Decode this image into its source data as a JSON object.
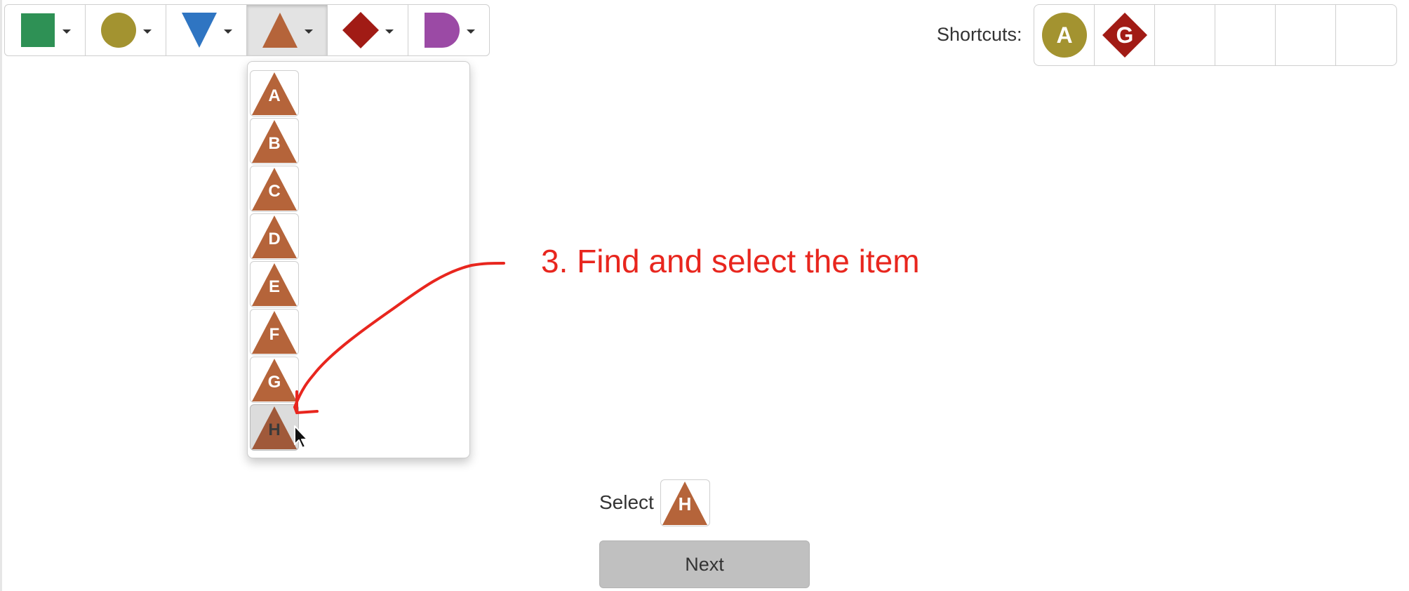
{
  "toolbar": {
    "buttons": [
      {
        "shape": "square-icon",
        "color": "#2e9155"
      },
      {
        "shape": "circle-icon",
        "color": "#a39330"
      },
      {
        "shape": "down-triangle-icon",
        "color": "#2f75c2"
      },
      {
        "shape": "triangle-icon",
        "color": "#b5643a",
        "active": true
      },
      {
        "shape": "diamond-icon",
        "color": "#a11b15"
      },
      {
        "shape": "d-shape-icon",
        "color": "#9b4aa5"
      }
    ]
  },
  "shortcuts": {
    "label": "Shortcuts:",
    "items": [
      {
        "shape": "circle-icon",
        "color": "#a39330",
        "letter": "A"
      },
      {
        "shape": "diamond-icon",
        "color": "#a11b15",
        "letter": "G"
      }
    ],
    "empty_slots": 4
  },
  "dropdown": {
    "shape": "triangle-icon",
    "color": "#b5643a",
    "items": [
      {
        "letter": "A"
      },
      {
        "letter": "B"
      },
      {
        "letter": "C"
      },
      {
        "letter": "D"
      },
      {
        "letter": "E"
      },
      {
        "letter": "F"
      },
      {
        "letter": "G"
      },
      {
        "letter": "H",
        "hovered": true
      }
    ]
  },
  "instruction": {
    "text": "3. Find and select the item",
    "color": "#e8261e"
  },
  "task": {
    "select_label": "Select",
    "target": {
      "shape": "triangle-icon",
      "color": "#b5643a",
      "letter": "H"
    },
    "next_label": "Next"
  }
}
